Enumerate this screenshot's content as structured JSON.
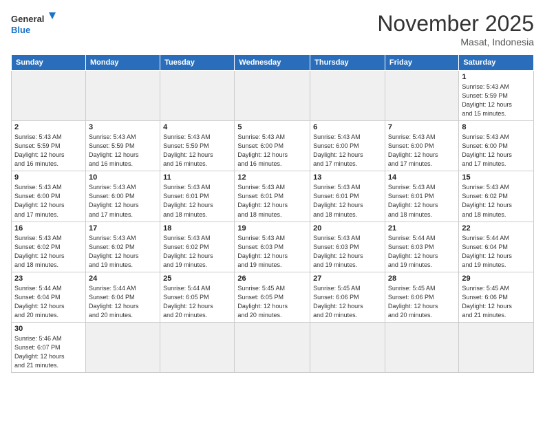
{
  "logo": {
    "line1": "General",
    "line2": "Blue"
  },
  "title": "November 2025",
  "location": "Masat, Indonesia",
  "days_of_week": [
    "Sunday",
    "Monday",
    "Tuesday",
    "Wednesday",
    "Thursday",
    "Friday",
    "Saturday"
  ],
  "weeks": [
    [
      {
        "day": "",
        "info": "",
        "empty": true
      },
      {
        "day": "",
        "info": "",
        "empty": true
      },
      {
        "day": "",
        "info": "",
        "empty": true
      },
      {
        "day": "",
        "info": "",
        "empty": true
      },
      {
        "day": "",
        "info": "",
        "empty": true
      },
      {
        "day": "",
        "info": "",
        "empty": true
      },
      {
        "day": "1",
        "info": "Sunrise: 5:43 AM\nSunset: 5:59 PM\nDaylight: 12 hours\nand 15 minutes.",
        "empty": false
      }
    ],
    [
      {
        "day": "2",
        "info": "Sunrise: 5:43 AM\nSunset: 5:59 PM\nDaylight: 12 hours\nand 16 minutes.",
        "empty": false
      },
      {
        "day": "3",
        "info": "Sunrise: 5:43 AM\nSunset: 5:59 PM\nDaylight: 12 hours\nand 16 minutes.",
        "empty": false
      },
      {
        "day": "4",
        "info": "Sunrise: 5:43 AM\nSunset: 5:59 PM\nDaylight: 12 hours\nand 16 minutes.",
        "empty": false
      },
      {
        "day": "5",
        "info": "Sunrise: 5:43 AM\nSunset: 6:00 PM\nDaylight: 12 hours\nand 16 minutes.",
        "empty": false
      },
      {
        "day": "6",
        "info": "Sunrise: 5:43 AM\nSunset: 6:00 PM\nDaylight: 12 hours\nand 17 minutes.",
        "empty": false
      },
      {
        "day": "7",
        "info": "Sunrise: 5:43 AM\nSunset: 6:00 PM\nDaylight: 12 hours\nand 17 minutes.",
        "empty": false
      },
      {
        "day": "8",
        "info": "Sunrise: 5:43 AM\nSunset: 6:00 PM\nDaylight: 12 hours\nand 17 minutes.",
        "empty": false
      }
    ],
    [
      {
        "day": "9",
        "info": "Sunrise: 5:43 AM\nSunset: 6:00 PM\nDaylight: 12 hours\nand 17 minutes.",
        "empty": false
      },
      {
        "day": "10",
        "info": "Sunrise: 5:43 AM\nSunset: 6:00 PM\nDaylight: 12 hours\nand 17 minutes.",
        "empty": false
      },
      {
        "day": "11",
        "info": "Sunrise: 5:43 AM\nSunset: 6:01 PM\nDaylight: 12 hours\nand 18 minutes.",
        "empty": false
      },
      {
        "day": "12",
        "info": "Sunrise: 5:43 AM\nSunset: 6:01 PM\nDaylight: 12 hours\nand 18 minutes.",
        "empty": false
      },
      {
        "day": "13",
        "info": "Sunrise: 5:43 AM\nSunset: 6:01 PM\nDaylight: 12 hours\nand 18 minutes.",
        "empty": false
      },
      {
        "day": "14",
        "info": "Sunrise: 5:43 AM\nSunset: 6:01 PM\nDaylight: 12 hours\nand 18 minutes.",
        "empty": false
      },
      {
        "day": "15",
        "info": "Sunrise: 5:43 AM\nSunset: 6:02 PM\nDaylight: 12 hours\nand 18 minutes.",
        "empty": false
      }
    ],
    [
      {
        "day": "16",
        "info": "Sunrise: 5:43 AM\nSunset: 6:02 PM\nDaylight: 12 hours\nand 18 minutes.",
        "empty": false
      },
      {
        "day": "17",
        "info": "Sunrise: 5:43 AM\nSunset: 6:02 PM\nDaylight: 12 hours\nand 19 minutes.",
        "empty": false
      },
      {
        "day": "18",
        "info": "Sunrise: 5:43 AM\nSunset: 6:02 PM\nDaylight: 12 hours\nand 19 minutes.",
        "empty": false
      },
      {
        "day": "19",
        "info": "Sunrise: 5:43 AM\nSunset: 6:03 PM\nDaylight: 12 hours\nand 19 minutes.",
        "empty": false
      },
      {
        "day": "20",
        "info": "Sunrise: 5:43 AM\nSunset: 6:03 PM\nDaylight: 12 hours\nand 19 minutes.",
        "empty": false
      },
      {
        "day": "21",
        "info": "Sunrise: 5:44 AM\nSunset: 6:03 PM\nDaylight: 12 hours\nand 19 minutes.",
        "empty": false
      },
      {
        "day": "22",
        "info": "Sunrise: 5:44 AM\nSunset: 6:04 PM\nDaylight: 12 hours\nand 19 minutes.",
        "empty": false
      }
    ],
    [
      {
        "day": "23",
        "info": "Sunrise: 5:44 AM\nSunset: 6:04 PM\nDaylight: 12 hours\nand 20 minutes.",
        "empty": false
      },
      {
        "day": "24",
        "info": "Sunrise: 5:44 AM\nSunset: 6:04 PM\nDaylight: 12 hours\nand 20 minutes.",
        "empty": false
      },
      {
        "day": "25",
        "info": "Sunrise: 5:44 AM\nSunset: 6:05 PM\nDaylight: 12 hours\nand 20 minutes.",
        "empty": false
      },
      {
        "day": "26",
        "info": "Sunrise: 5:45 AM\nSunset: 6:05 PM\nDaylight: 12 hours\nand 20 minutes.",
        "empty": false
      },
      {
        "day": "27",
        "info": "Sunrise: 5:45 AM\nSunset: 6:06 PM\nDaylight: 12 hours\nand 20 minutes.",
        "empty": false
      },
      {
        "day": "28",
        "info": "Sunrise: 5:45 AM\nSunset: 6:06 PM\nDaylight: 12 hours\nand 20 minutes.",
        "empty": false
      },
      {
        "day": "29",
        "info": "Sunrise: 5:45 AM\nSunset: 6:06 PM\nDaylight: 12 hours\nand 21 minutes.",
        "empty": false
      }
    ],
    [
      {
        "day": "30",
        "info": "Sunrise: 5:46 AM\nSunset: 6:07 PM\nDaylight: 12 hours\nand 21 minutes.",
        "empty": false
      },
      {
        "day": "",
        "info": "",
        "empty": true
      },
      {
        "day": "",
        "info": "",
        "empty": true
      },
      {
        "day": "",
        "info": "",
        "empty": true
      },
      {
        "day": "",
        "info": "",
        "empty": true
      },
      {
        "day": "",
        "info": "",
        "empty": true
      },
      {
        "day": "",
        "info": "",
        "empty": true
      }
    ]
  ]
}
